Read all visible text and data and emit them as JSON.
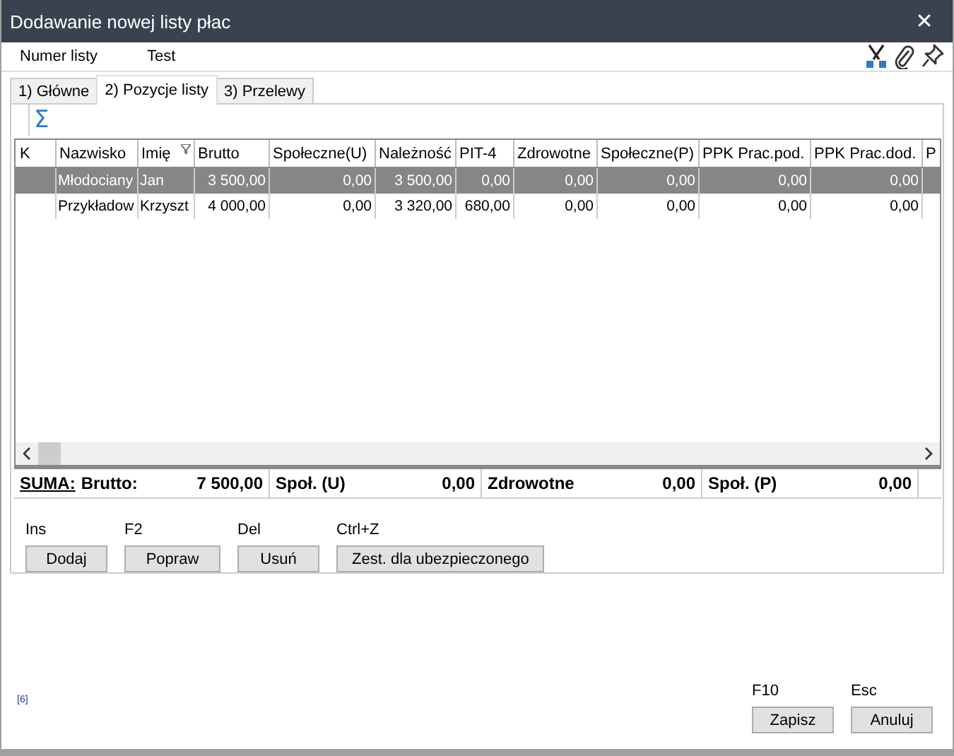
{
  "window": {
    "title": "Dodawanie nowej listy płac",
    "close": "✕"
  },
  "header": {
    "label": "Numer listy",
    "value": "Test"
  },
  "tabs": [
    {
      "label": "1) Główne",
      "selected": false
    },
    {
      "label": "2) Pozycje listy",
      "selected": true
    },
    {
      "label": "3) Przelewy",
      "selected": false
    }
  ],
  "sum_button": "Σ",
  "table": {
    "columns": [
      {
        "label": "K",
        "filter": false
      },
      {
        "label": "Nazwisko",
        "filter": false
      },
      {
        "label": "Imię",
        "filter": true
      },
      {
        "label": "Brutto",
        "filter": false
      },
      {
        "label": "Społeczne(U)",
        "filter": false
      },
      {
        "label": "Należność",
        "filter": false
      },
      {
        "label": "PIT-4",
        "filter": false
      },
      {
        "label": "Zdrowotne",
        "filter": false
      },
      {
        "label": "Społeczne(P)",
        "filter": false
      },
      {
        "label": "PPK Prac.pod.",
        "filter": false
      },
      {
        "label": "PPK Prac.dod.",
        "filter": false
      },
      {
        "label": "P",
        "filter": false
      }
    ],
    "rows": [
      {
        "selected": true,
        "cells": [
          "",
          "Młodociany",
          "Jan",
          "3 500,00",
          "0,00",
          "3 500,00",
          "0,00",
          "0,00",
          "0,00",
          "0,00",
          "0,00",
          ""
        ]
      },
      {
        "selected": false,
        "cells": [
          "",
          "Przykładow",
          "Krzyszt",
          "4 000,00",
          "0,00",
          "3 320,00",
          "680,00",
          "0,00",
          "0,00",
          "0,00",
          "0,00",
          ""
        ]
      }
    ]
  },
  "summary": {
    "title": "SUMA:",
    "items": [
      {
        "label": "Brutto:",
        "value": "7 500,00"
      },
      {
        "label": "Społ. (U)",
        "value": "0,00"
      },
      {
        "label": "Zdrowotne",
        "value": "0,00"
      },
      {
        "label": "Społ. (P)",
        "value": "0,00"
      }
    ]
  },
  "actions": [
    {
      "shortcut": "Ins",
      "label": "Dodaj"
    },
    {
      "shortcut": "F2",
      "label": "Popraw"
    },
    {
      "shortcut": "Del",
      "label": "Usuń"
    },
    {
      "shortcut": "Ctrl+Z",
      "label": "Zest. dla ubezpieczonego"
    }
  ],
  "footer_note": "[6]",
  "dialog_buttons": [
    {
      "shortcut": "F10",
      "label": "Zapisz"
    },
    {
      "shortcut": "Esc",
      "label": "Anuluj"
    }
  ]
}
